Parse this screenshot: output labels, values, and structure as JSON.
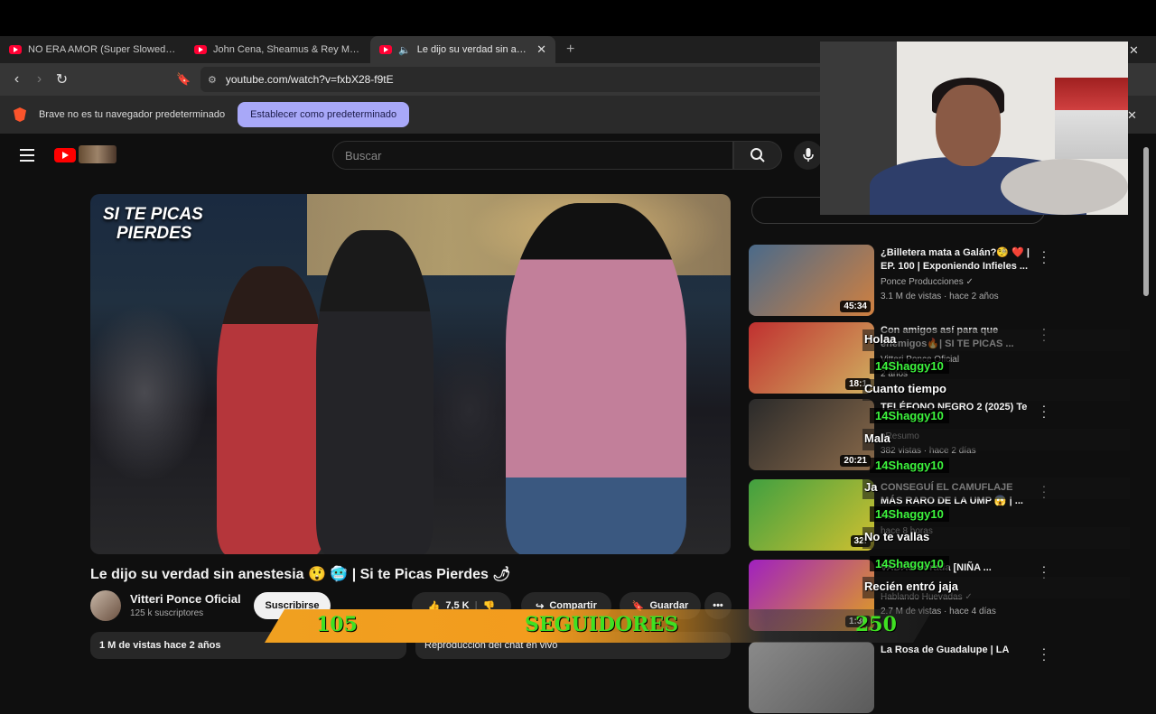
{
  "browser": {
    "tabs": [
      {
        "title": "NO ERA AMOR (Super Slowed) - You"
      },
      {
        "title": "John Cena, Sheamus & Rey Mysterio"
      },
      {
        "title": "Le dijo su verdad sin anestesi"
      }
    ],
    "url": "youtube.com/watch?v=fxbX28-f9tE",
    "infobar": {
      "message": "Brave no es tu navegador predeterminado",
      "button": "Establecer como predeterminado"
    }
  },
  "youtube": {
    "search_placeholder": "Buscar",
    "video": {
      "overlay_line1": "SI TE PICAS",
      "overlay_line2": "PIERDES",
      "title": "Le dijo su verdad sin anestesia 😲 🥶 | Si te Picas Pierdes 🌶",
      "channel": "Vitteri Ponce Oficial",
      "subscribers": "125 k suscriptores",
      "subscribe_label": "Suscribirse",
      "likes": "7,5 K",
      "share_label": "Compartir",
      "save_label": "Guardar",
      "description_stats": "1 M de vistas  hace 2 años",
      "chat_replay_label": "Reproducción del chat en vivo"
    },
    "recommendations": [
      {
        "title": "¿Billetera mata a Galán?🧐 ❤️ | EP. 100 | Exponiendo Infieles ...",
        "channel": "Ponce Producciones ✓",
        "meta": "3.1 M de vistas · hace 2 años",
        "duration": "45:34",
        "colors": [
          "#4a6a8a",
          "#d08040"
        ]
      },
      {
        "title": "Con amigos así para que enemigos🔥| SI TE PICAS ...",
        "channel": "Vitteri Ponce Oficial",
        "meta": "2 años",
        "duration": "18:1",
        "colors": [
          "#c03030",
          "#d0b060"
        ]
      },
      {
        "title": "TELÉFONO NEGRO 2 (2025) Te",
        "channel": "oResumo",
        "meta": "382 vistas · hace 2 días",
        "duration": "20:21",
        "colors": [
          "#2a2a2a",
          "#8a6a4a"
        ]
      },
      {
        "title": "CONSEGUÍ EL CAMUFLAJE MÁS RARO DE LA UMP 😱 | ...",
        "channel": "Nuevo",
        "meta": "hace 8 horas",
        "duration": "32:",
        "colors": [
          "#40a040",
          "#d0c030"
        ]
      },
      {
        "title": "VADAS - orada [NIÑA ...",
        "channel": "Hablando Huevadas ✓",
        "meta": "2.7 M de vistas · hace 4 días",
        "duration": "1:30",
        "colors": [
          "#a020c0",
          "#e0a020"
        ]
      },
      {
        "title": "La Rosa de Guadalupe | LA",
        "channel": "",
        "meta": "",
        "duration": "",
        "colors": [
          "#8a8a8a",
          "#5a5a5a"
        ]
      }
    ]
  },
  "stream_overlay": {
    "chat": [
      {
        "message": "Holaa",
        "user": "14Shaggy10"
      },
      {
        "message": "Cuanto tiempo",
        "user": "14Shaggy10"
      },
      {
        "message": "Mala",
        "user": "14Shaggy10"
      },
      {
        "message": "Ja",
        "user": "14Shaggy10"
      },
      {
        "message": "No te vallas",
        "user": "14Shaggy10"
      },
      {
        "message": "Recién entró jaja",
        "user": ""
      }
    ],
    "goal": {
      "current": "105",
      "label": "SEGUIDORES",
      "target": "250",
      "progress": 0.42
    }
  }
}
